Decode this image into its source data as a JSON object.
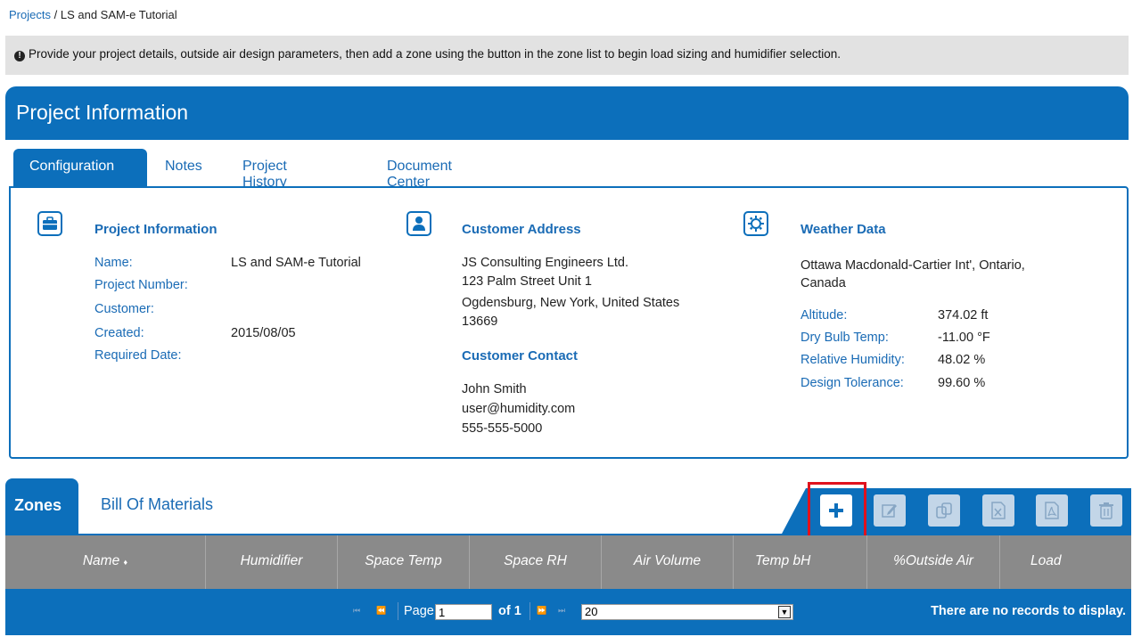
{
  "breadcrumb": {
    "root": "Projects",
    "separator": "/",
    "current": "LS and SAM-e Tutorial"
  },
  "notice": {
    "text": "Provide your project details, outside air design parameters, then add a zone using the button in the zone list to begin load sizing and humidifier selection."
  },
  "project_header": {
    "title": "Project Information"
  },
  "tabs": [
    {
      "label": "Configuration",
      "active": true
    },
    {
      "label": "Notes"
    },
    {
      "label": "Project History"
    },
    {
      "label": "Document Center"
    }
  ],
  "project_info": {
    "title": "Project Information",
    "name_label": "Name:",
    "name_value": "LS and SAM-e Tutorial",
    "number_label": "Project Number:",
    "number_value": "",
    "customer_label": "Customer:",
    "customer_value": "",
    "created_label": "Created:",
    "created_value": "2015/08/05",
    "required_label": "Required Date:",
    "required_value": ""
  },
  "customer_address": {
    "title": "Customer Address",
    "line1": "JS Consulting Engineers Ltd.",
    "line2": "123 Palm Street Unit 1",
    "line3": "Ogdensburg, New York, United States",
    "line4": "13669"
  },
  "customer_contact": {
    "title": "Customer Contact",
    "name": "John Smith",
    "email": "user@humidity.com",
    "phone": "555-555-5000"
  },
  "weather": {
    "title": "Weather Data",
    "location_line1": "Ottawa Macdonald-Cartier Int', Ontario,",
    "location_line2": "Canada",
    "altitude_label": "Altitude:",
    "altitude_value": "374.02 ft",
    "drybulb_label": "Dry Bulb Temp:",
    "drybulb_value": "-11.00 °F",
    "rh_label": "Relative Humidity:",
    "rh_value": "48.02 %",
    "tolerance_label": "Design Tolerance:",
    "tolerance_value": "99.60 %"
  },
  "zones": {
    "tab_zones": "Zones",
    "tab_bom": "Bill Of Materials",
    "columns": [
      "Name",
      "Humidifier",
      "Space Temp",
      "Space RH",
      "Air Volume",
      "Temp bH",
      "%Outside Air",
      "Load"
    ],
    "sort_indicator": "♦"
  },
  "pager": {
    "page_label": "Page",
    "page_value": "1",
    "of_label": "of 1",
    "page_size": "20",
    "empty_message": "There are no records to display."
  },
  "colors": {
    "primary": "#0c6fbb",
    "header_gray": "#8a8a8a",
    "highlight": "#e0121d"
  },
  "icons": [
    "info-icon",
    "briefcase-icon",
    "user-icon",
    "gear-icon",
    "add-icon",
    "edit-icon",
    "copy-icon",
    "excel-icon",
    "pdf-icon",
    "trash-icon"
  ]
}
